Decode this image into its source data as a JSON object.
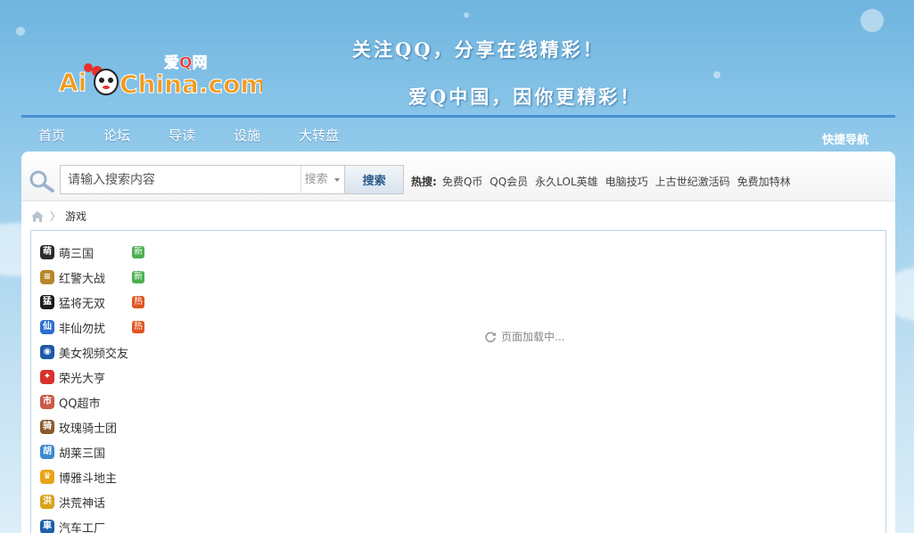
{
  "header": {
    "logo_text_cn": "爱Q网",
    "logo_text_en": "AiQChina.com",
    "slogan1": "关注QQ，分享在线精彩！",
    "slogan2": "爱Q中国，因你更精彩！",
    "brand_colors": {
      "logo_red": "#e8322b",
      "logo_orange": "#f29a1d",
      "nav_line": "#4a8ed3"
    }
  },
  "nav": {
    "items": [
      {
        "label": "首页"
      },
      {
        "label": "论坛"
      },
      {
        "label": "导读"
      },
      {
        "label": "设施"
      },
      {
        "label": "大转盘"
      }
    ],
    "quick_nav": "快捷导航"
  },
  "search": {
    "placeholder": "请输入搜索内容",
    "type_selected": "搜索",
    "button": "搜索",
    "hot_label": "热搜:",
    "hot_links": [
      "免费Q币",
      "QQ会员",
      "永久LOL英雄",
      "电脑技巧",
      "上古世纪激活码",
      "免费加特林"
    ]
  },
  "breadcrumb": {
    "current": "游戏"
  },
  "games": [
    {
      "name": "萌三国",
      "icon": "mengsanguo-icon",
      "icon_color": "#2a2a2a",
      "glyph": "萌",
      "badge": "新",
      "badge_color": "#4caf50"
    },
    {
      "name": "红警大战",
      "icon": "redalert-icon",
      "icon_color": "#b8862a",
      "glyph": "≋",
      "badge": "新",
      "badge_color": "#4caf50"
    },
    {
      "name": "猛将无双",
      "icon": "mengjiang-icon",
      "icon_color": "#1a1a1a",
      "glyph": "猛",
      "badge": "热",
      "badge_color": "#e0541f"
    },
    {
      "name": "非仙勿扰",
      "icon": "feixian-icon",
      "icon_color": "#2d6fcf",
      "glyph": "仙",
      "badge": "热",
      "badge_color": "#e0541f"
    },
    {
      "name": "美女视频交友",
      "icon": "video-chat-icon",
      "icon_color": "#1d5aa8",
      "glyph": "◉",
      "badge": "",
      "badge_color": ""
    },
    {
      "name": "荣光大亨",
      "icon": "rongguang-icon",
      "icon_color": "#d8322a",
      "glyph": "✦",
      "badge": "",
      "badge_color": ""
    },
    {
      "name": "QQ超市",
      "icon": "qq-supermarket-icon",
      "icon_color": "#c85a4a",
      "glyph": "市",
      "badge": "",
      "badge_color": ""
    },
    {
      "name": "玫瑰骑士团",
      "icon": "rose-knight-icon",
      "icon_color": "#8a5a2a",
      "glyph": "骑",
      "badge": "",
      "badge_color": ""
    },
    {
      "name": "胡莱三国",
      "icon": "hulai-icon",
      "icon_color": "#3a8ad0",
      "glyph": "胡",
      "badge": "",
      "badge_color": ""
    },
    {
      "name": "博雅斗地主",
      "icon": "boya-doudizhu-icon",
      "icon_color": "#e8a418",
      "glyph": "♛",
      "badge": "",
      "badge_color": ""
    },
    {
      "name": "洪荒神话",
      "icon": "honghuang-icon",
      "icon_color": "#d9a21a",
      "glyph": "洪",
      "badge": "",
      "badge_color": ""
    },
    {
      "name": "汽车工厂",
      "icon": "car-factory-icon",
      "icon_color": "#1f5fa8",
      "glyph": "車",
      "badge": "",
      "badge_color": ""
    }
  ],
  "loading_text": "页面加载中..."
}
